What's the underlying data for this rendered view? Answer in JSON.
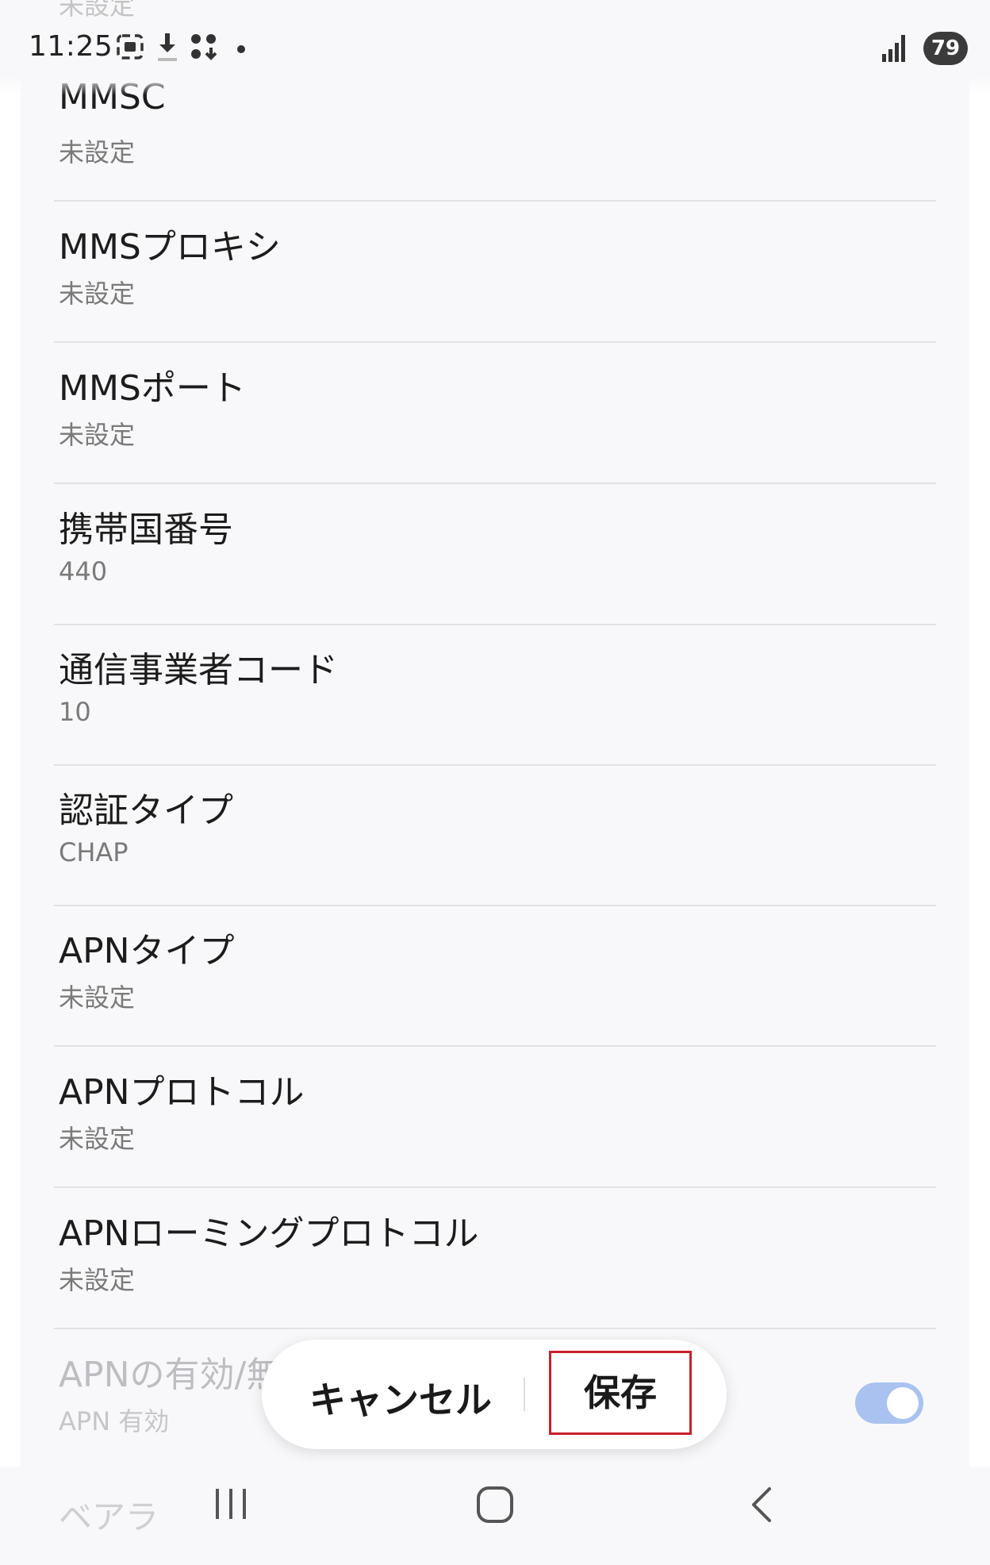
{
  "status_bar": {
    "time": "11:25",
    "battery_level": "79",
    "icons": [
      "screenshot-icon",
      "download-icon",
      "app-grid-icon",
      "notification-dot-icon",
      "signal-icon"
    ]
  },
  "partial_top_text": "未設定",
  "list": [
    {
      "title": "MMSC",
      "value": "未設定"
    },
    {
      "title": "MMSプロキシ",
      "value": "未設定"
    },
    {
      "title": "MMSポート",
      "value": "未設定"
    },
    {
      "title": "携帯国番号",
      "value": "440"
    },
    {
      "title": "通信事業者コード",
      "value": "10"
    },
    {
      "title": "認証タイプ",
      "value": "CHAP"
    },
    {
      "title": "APNタイプ",
      "value": "未設定"
    },
    {
      "title": "APNプロトコル",
      "value": "未設定"
    },
    {
      "title": "APNローミングプロトコル",
      "value": "未設定"
    }
  ],
  "apn_toggle": {
    "title": "APNの有効/無効",
    "value": "APN 有効",
    "enabled": true
  },
  "actions": {
    "cancel": "キャンセル",
    "save": "保存"
  },
  "nav": {
    "partial_text": "ベアラ"
  }
}
